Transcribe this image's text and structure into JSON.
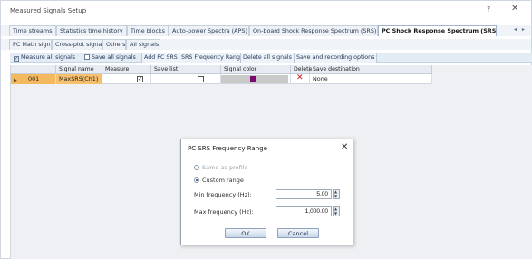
{
  "window": {
    "title": "Measured Signals Setup",
    "help_glyph": "?",
    "close_glyph": "✕"
  },
  "tabs_row1": [
    {
      "label": "Time streams",
      "active": false
    },
    {
      "label": "Statistics time history",
      "active": false
    },
    {
      "label": "Time blocks",
      "active": false
    },
    {
      "label": "Auto-power Spectra (APS)",
      "active": false
    },
    {
      "label": "On-board Shock Response Spectrum (SRS)",
      "active": false
    },
    {
      "label": "PC Shock Response Spectrum (SRS)",
      "active": true
    }
  ],
  "tabs_row2": [
    {
      "label": "PC Math signals",
      "active": false
    },
    {
      "label": "Cross-plot signals",
      "active": false
    },
    {
      "label": "Others",
      "active": false
    },
    {
      "label": "All signals",
      "active": false
    }
  ],
  "tab_scroll": {
    "icons": [
      "chevron-left-icon",
      "chevron-right-icon"
    ],
    "glyphs": "◂ ▸"
  },
  "toolbar": {
    "measure_all_label": "Measure all signals",
    "measure_all_checked": true,
    "save_all_label": "Save all signals",
    "save_all_checked": false,
    "add_pc_srs_label": "Add PC SRS",
    "srs_freq_range_label": "SRS Frequency Range",
    "delete_all_label": "Delete all signals",
    "save_recording_label": "Save and recording options"
  },
  "table": {
    "columns": [
      "Signal name",
      "Measure",
      "Save list",
      "Signal color",
      "Delete",
      "Save destination"
    ],
    "rows": [
      {
        "id": "001",
        "signal_name": "MaxSRS(Ch1)",
        "measure": true,
        "save_list": false,
        "signal_color": "#7a0a6e",
        "delete_glyph": "✕",
        "save_destination": "None"
      }
    ]
  },
  "dialog": {
    "title": "PC SRS Frequency Range",
    "close_glyph": "✕",
    "option_same_label": "Same as profile",
    "option_custom_label": "Custom range",
    "selected_option": "custom",
    "min_label": "Min frequency (Hz):",
    "min_value": "5.00",
    "max_label": "Max frequency (Hz):",
    "max_value": "1,000.00",
    "ok_label": "OK",
    "cancel_label": "Cancel"
  },
  "colors": {
    "row_highlight": "#f6c06d",
    "active_tab_text": "#111111",
    "delete_red": "#d0191b"
  }
}
